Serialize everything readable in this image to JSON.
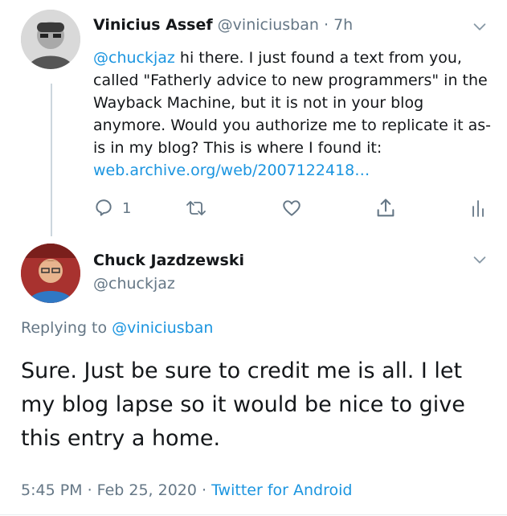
{
  "tweet1": {
    "author_name": "Vinicius Assef",
    "handle": "@viniciusban",
    "time_sep": " · ",
    "time": "7h",
    "mention": "@chuckjaz",
    "text": " hi there. I just found a text from you, called \"Fatherly advice to new programmers\" in the Wayback Machine, but it is not in your blog anymore. Would you authorize me to replicate it as-is in my blog? This is where I found it:",
    "link_text": "web.archive.org/web/2007122418…",
    "reply_count": "1",
    "icons": [
      "reply-icon",
      "retweet-icon",
      "like-icon",
      "share-icon",
      "analytics-icon",
      "chevron-down-icon"
    ]
  },
  "tweet2": {
    "author_name": "Chuck Jazdzewski",
    "handle": "@chuckjaz",
    "replying_prefix": "Replying to ",
    "replying_handle": "@viniciusban",
    "text": "Sure. Just be sure to credit me is all. I let my blog lapse so it would be nice to give this entry a home.",
    "timestamp": "5:45 PM · Feb 25, 2020 · ",
    "source": "Twitter for Android"
  },
  "colors": {
    "link": "#1b95e0",
    "muted": "#657786",
    "text": "#14171a"
  }
}
